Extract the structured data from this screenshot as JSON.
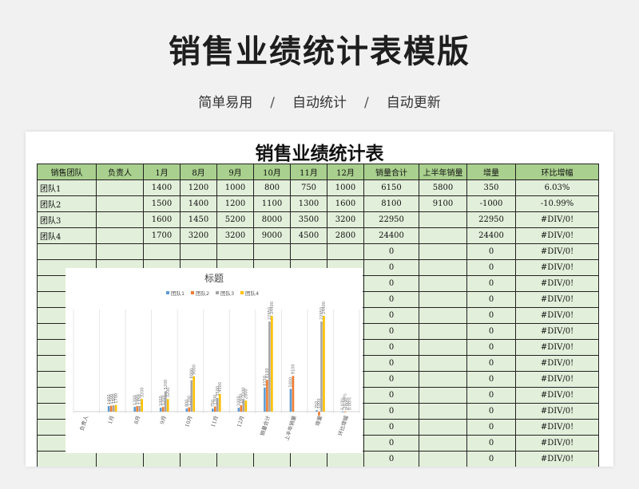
{
  "page": {
    "title": "销售业绩统计表模版",
    "tags": [
      "简单易用",
      "自动统计",
      "自动更新"
    ],
    "separator": "/"
  },
  "sheet": {
    "title": "销售业绩统计表",
    "headers": [
      "销售团队",
      "负责人",
      "1月",
      "8月",
      "9月",
      "10月",
      "11月",
      "12月",
      "销量合计",
      "上半年销量",
      "增量",
      "环比增幅"
    ],
    "rows": [
      [
        "团队1",
        "",
        "1400",
        "1200",
        "1000",
        "800",
        "750",
        "1000",
        "6150",
        "5800",
        "350",
        "6.03%"
      ],
      [
        "团队2",
        "",
        "1500",
        "1400",
        "1200",
        "1100",
        "1300",
        "1600",
        "8100",
        "9100",
        "-1000",
        "-10.99%"
      ],
      [
        "团队3",
        "",
        "1600",
        "1450",
        "5200",
        "8000",
        "3500",
        "3200",
        "22950",
        "",
        "22950",
        "#DIV/0!"
      ],
      [
        "团队4",
        "",
        "1700",
        "3200",
        "3200",
        "9000",
        "4500",
        "2800",
        "24400",
        "",
        "24400",
        "#DIV/0!"
      ],
      [
        "",
        "",
        "",
        "",
        "",
        "",
        "",
        "",
        "0",
        "",
        "0",
        "#DIV/0!"
      ],
      [
        "",
        "",
        "",
        "",
        "",
        "",
        "",
        "",
        "0",
        "",
        "0",
        "#DIV/0!"
      ],
      [
        "",
        "",
        "",
        "",
        "",
        "",
        "",
        "",
        "0",
        "",
        "0",
        "#DIV/0!"
      ],
      [
        "",
        "",
        "",
        "",
        "",
        "",
        "",
        "",
        "0",
        "",
        "0",
        "#DIV/0!"
      ],
      [
        "",
        "",
        "",
        "",
        "",
        "",
        "",
        "",
        "0",
        "",
        "0",
        "#DIV/0!"
      ],
      [
        "",
        "",
        "",
        "",
        "",
        "",
        "",
        "",
        "0",
        "",
        "0",
        "#DIV/0!"
      ],
      [
        "",
        "",
        "",
        "",
        "",
        "",
        "",
        "",
        "0",
        "",
        "0",
        "#DIV/0!"
      ],
      [
        "",
        "",
        "",
        "",
        "",
        "",
        "",
        "",
        "0",
        "",
        "0",
        "#DIV/0!"
      ],
      [
        "",
        "",
        "",
        "",
        "",
        "",
        "",
        "",
        "0",
        "",
        "0",
        "#DIV/0!"
      ],
      [
        "",
        "",
        "",
        "",
        "",
        "",
        "",
        "",
        "0",
        "",
        "0",
        "#DIV/0!"
      ],
      [
        "",
        "",
        "",
        "",
        "",
        "",
        "",
        "",
        "0",
        "",
        "0",
        "#DIV/0!"
      ],
      [
        "",
        "",
        "",
        "",
        "",
        "",
        "",
        "",
        "0",
        "",
        "0",
        "#DIV/0!"
      ],
      [
        "",
        "",
        "",
        "",
        "",
        "",
        "",
        "",
        "0",
        "",
        "0",
        "#DIV/0!"
      ],
      [
        "",
        "",
        "",
        "",
        "",
        "",
        "",
        "",
        "0",
        "",
        "0",
        "#DIV/0!"
      ]
    ]
  },
  "chart_data": {
    "type": "bar",
    "title": "标题",
    "legend_position": "top",
    "grid": false,
    "categories": [
      "负责人",
      "1月",
      "8月",
      "9月",
      "10月",
      "11月",
      "12月",
      "销量合计",
      "上半年销量",
      "增量",
      "环比增幅"
    ],
    "series": [
      {
        "name": "团队1",
        "color": "#5b9bd5",
        "values": [
          0,
          1400,
          1200,
          1000,
          800,
          750,
          1000,
          6150,
          5800,
          350,
          0.0603
        ],
        "labels": [
          "",
          "1400",
          "1200",
          "1000",
          "800",
          "750",
          "1000",
          "6150",
          "5800",
          "350",
          "6.03%"
        ]
      },
      {
        "name": "团队2",
        "color": "#ed7d31",
        "values": [
          0,
          1500,
          1400,
          1200,
          1100,
          1300,
          1600,
          8100,
          9100,
          -1000,
          -0.1099
        ],
        "labels": [
          "",
          "1500",
          "1400",
          "1200",
          "1100",
          "1300",
          "1600",
          "8100",
          "9100",
          "-1000",
          "-10.99%"
        ]
      },
      {
        "name": "团队3",
        "color": "#a5a5a5",
        "values": [
          0,
          1600,
          1450,
          5200,
          8000,
          3500,
          3200,
          22950,
          0,
          22950,
          0
        ],
        "labels": [
          "",
          "1600",
          "1450",
          "5200",
          "8000",
          "3500",
          "3200",
          "22950",
          "",
          "22950",
          "0.00%"
        ]
      },
      {
        "name": "团队4",
        "color": "#ffc000",
        "values": [
          0,
          1700,
          3200,
          3200,
          9000,
          4500,
          2800,
          24400,
          0,
          24400,
          0
        ],
        "labels": [
          "",
          "1700",
          "3200",
          "3200",
          "9000",
          "4500",
          "2800",
          "24400",
          "",
          "24400",
          "0.00%"
        ]
      }
    ],
    "ylim": [
      -1000,
      26000
    ]
  }
}
